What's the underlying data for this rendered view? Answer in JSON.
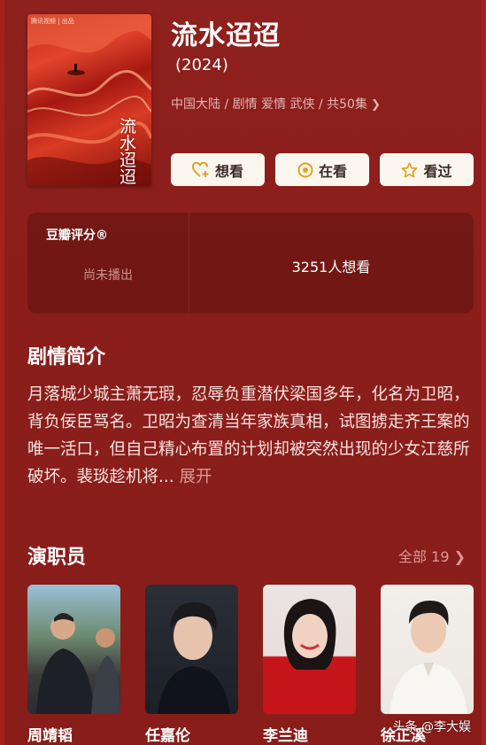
{
  "drama": {
    "title": "流水迢迢",
    "year": "(2024)",
    "meta": "中国大陆 / 剧情 爱情 武侠 / 共50集",
    "poster_corner": "腾讯视频 | 出品",
    "poster_title": "流水迢迢"
  },
  "actions": {
    "want": "想看",
    "watching": "在看",
    "watched": "看过"
  },
  "rating": {
    "label": "豆瓣评分®",
    "status": "尚未播出",
    "want_count": "3251人想看"
  },
  "plot": {
    "title": "剧情简介",
    "text": "月落城少城主萧无瑕，忍辱负重潜伏梁国多年，化名为卫昭，背负佞臣骂名。卫昭为查清当年家族真相，试图掳走齐王案的唯一活口，但自己精心布置的计划却被突然出现的少女江慈所破坏。裴琰趁机将...",
    "expand": "展开"
  },
  "cast": {
    "title": "演职员",
    "all_label": "全部 19",
    "members": [
      {
        "name": "周靖韬"
      },
      {
        "name": "任嘉伦"
      },
      {
        "name": "李兰迪"
      },
      {
        "name": "徐正溪"
      }
    ]
  },
  "watermark": "头条 @李大娱",
  "colors": {
    "background": "#8c1f1c",
    "button_bg": "#fbf6ee",
    "icon_accent": "#e0a31c"
  }
}
